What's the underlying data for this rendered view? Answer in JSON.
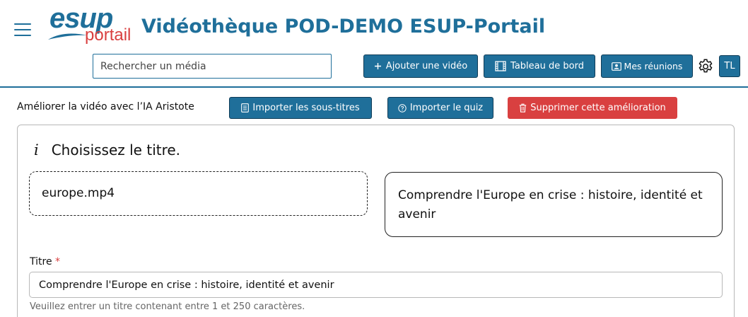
{
  "header": {
    "logo_text_top": "esup",
    "logo_text_bottom": "portail",
    "site_title": "Vidéothèque POD-DEMO ESUP-Portail",
    "search_placeholder": "Rechercher un média",
    "add_video_label": "Ajouter une vidéo",
    "dashboard_label": "Tableau de bord",
    "meetings_label": "Mes réunions",
    "avatar_initials": "TL",
    "icons": [
      "menu-icon",
      "plus-icon",
      "film-icon",
      "person-card-icon",
      "gear-icon"
    ]
  },
  "ai_bar": {
    "label": "Améliorer la vidéo avec l’IA Aristote",
    "import_subtitles_label": "Importer les sous-titres",
    "import_quiz_label": "Importer le quiz",
    "delete_label": "Supprimer cette amélioration"
  },
  "title_choice": {
    "heading_icon": "i",
    "heading": "Choisissez le titre.",
    "option_file": "europe.mp4",
    "option_ai": "Comprendre l'Europe en crise : histoire, identité et avenir"
  },
  "title_field": {
    "label": "Titre",
    "required_mark": "*",
    "value": "Comprendre l'Europe en crise : histoire, identité et avenir",
    "help": "Veuillez entrer un titre contenant entre 1 et 250 caractères."
  },
  "colors": {
    "primary": "#1f6f9a",
    "danger": "#d94040",
    "border": "#b8b8b8"
  }
}
